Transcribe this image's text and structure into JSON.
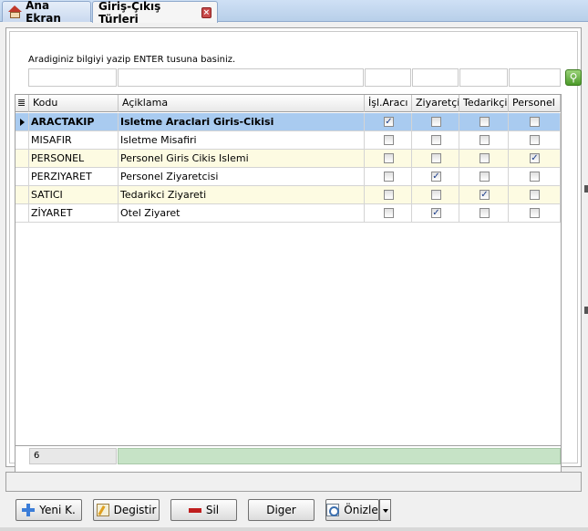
{
  "tabs": [
    {
      "label": "Ana Ekran",
      "icon": "home-icon"
    },
    {
      "label": "Giriş-Çıkış Türleri",
      "icon": "close-icon"
    }
  ],
  "search": {
    "hint": "Aradiginiz bilgiyi yazip ENTER tusuna basiniz."
  },
  "grid": {
    "columns": [
      "Kodu",
      "Açiklama",
      "İşl.Aracı",
      "Ziyaretçi",
      "Tedarikçi",
      "Personel"
    ],
    "rows": [
      {
        "kodu": "ARACTAKIP",
        "aciklama": "Isletme Araclari Giris-Cikisi",
        "isl_araci": true,
        "ziyaretci": false,
        "tedarikci": false,
        "personel": false,
        "selected": true
      },
      {
        "kodu": "MISAFIR",
        "aciklama": "Isletme Misafiri",
        "isl_araci": false,
        "ziyaretci": false,
        "tedarikci": false,
        "personel": false
      },
      {
        "kodu": "PERSONEL",
        "aciklama": "Personel Giris Cikis Islemi",
        "isl_araci": false,
        "ziyaretci": false,
        "tedarikci": false,
        "personel": true
      },
      {
        "kodu": "PERZIYARET",
        "aciklama": "Personel Ziyaretcisi",
        "isl_araci": false,
        "ziyaretci": true,
        "tedarikci": false,
        "personel": false
      },
      {
        "kodu": "SATICI",
        "aciklama": "Tedarikci Ziyareti",
        "isl_araci": false,
        "ziyaretci": false,
        "tedarikci": true,
        "personel": false
      },
      {
        "kodu": "ZİYARET",
        "aciklama": "Otel Ziyaret",
        "isl_araci": false,
        "ziyaretci": true,
        "tedarikci": false,
        "personel": false
      }
    ],
    "record_count": "6"
  },
  "toolbar": {
    "new_label": "Yeni K.",
    "edit_label": "Degistir",
    "delete_label": "Sil",
    "other_label": "Diger",
    "preview_label": "Önizle"
  },
  "colors": {
    "selected_row": "#a9cbf0",
    "alt_row": "#fdfbe2",
    "footer_bar": "#c6e3c6"
  }
}
